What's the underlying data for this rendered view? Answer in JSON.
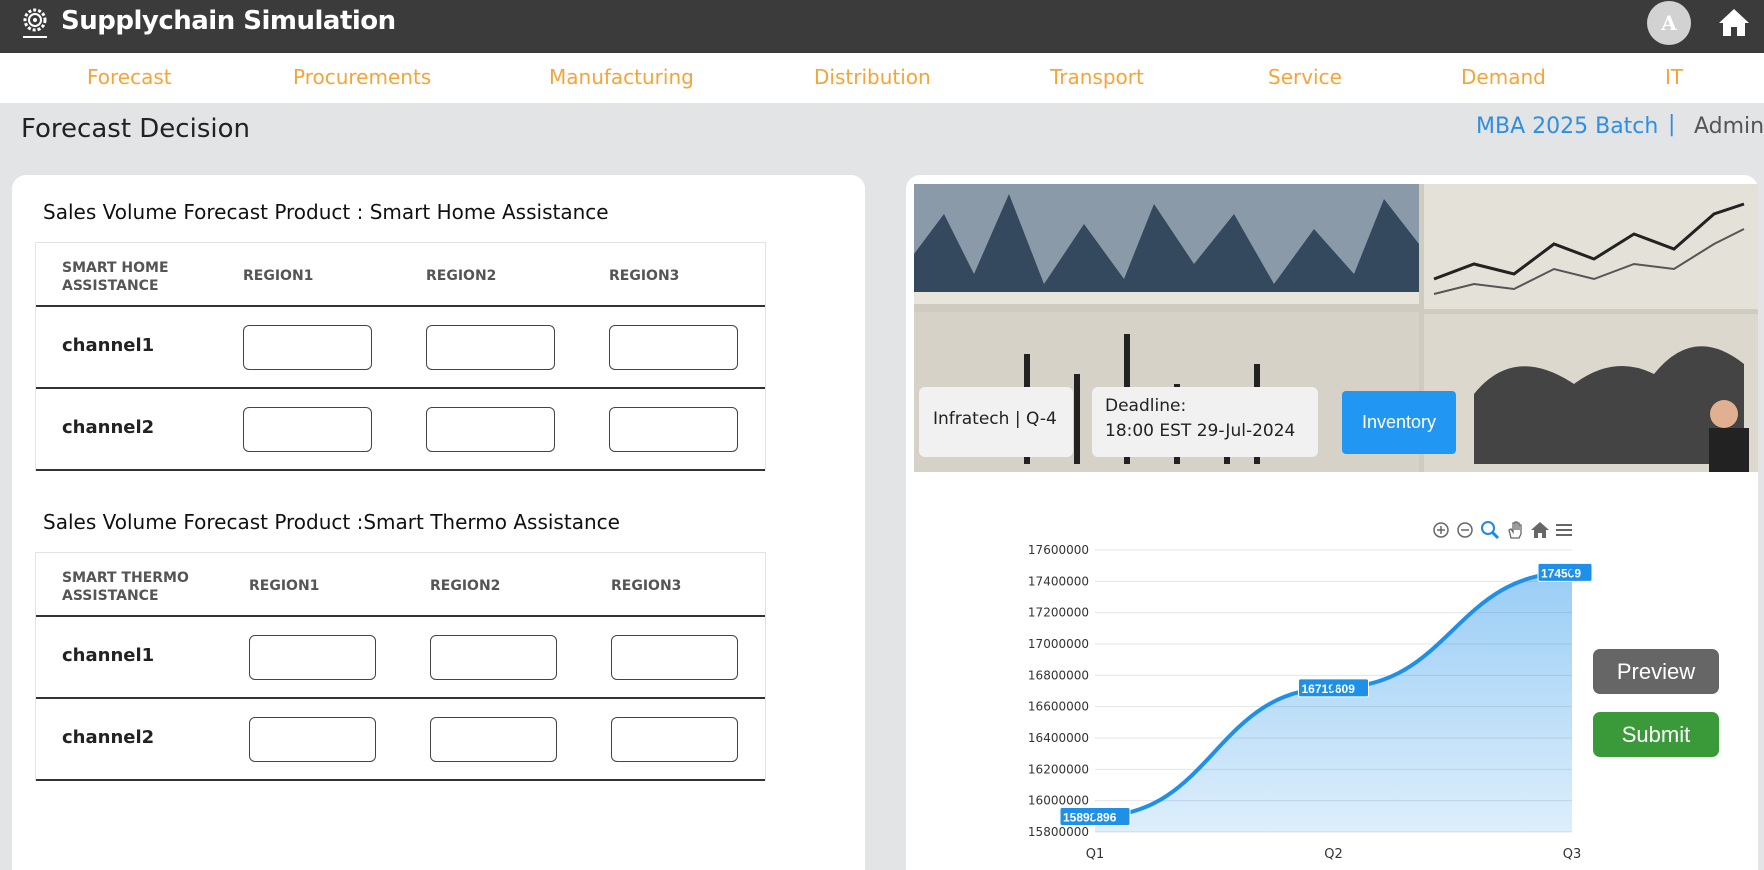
{
  "app": {
    "title": "Supplychain Simulation",
    "avatar_letter": "A"
  },
  "nav": [
    "Forecast",
    "Procurements",
    "Manufacturing",
    "Distribution",
    "Transport",
    "Service",
    "Demand",
    "IT"
  ],
  "page": {
    "title": "Forecast Decision",
    "batch": "MBA 2025 Batch",
    "separator": "|",
    "role": "Admin"
  },
  "table1": {
    "title": "Sales Volume Forecast Product : Smart Home Assistance",
    "headers": [
      "SMART HOME ASSISTANCE",
      "REGION1",
      "REGION2",
      "REGION3"
    ],
    "rows": [
      "channel1",
      "channel2"
    ]
  },
  "table2": {
    "title": "Sales Volume Forecast Product :Smart Thermo Assistance",
    "headers": [
      "SMART THERMO ASSISTANCE",
      "REGION1",
      "REGION2",
      "REGION3"
    ],
    "rows": [
      "channel1",
      "channel2"
    ]
  },
  "banner": {
    "company": "Infratech | Q-4",
    "deadline_label": "Deadline:",
    "deadline_value": "18:00 EST 29-Jul-2024",
    "inventory_button": "Inventory"
  },
  "chart_toolbar": [
    "zoom-in-icon",
    "zoom-out-icon",
    "selection-zoom-icon",
    "pan-icon",
    "reset-home-icon",
    "menu-icon"
  ],
  "chart_data": {
    "type": "area",
    "categories": [
      "Q1",
      "Q2",
      "Q3"
    ],
    "series": [
      {
        "values": [
          15898896,
          16719609,
          17456900
        ]
      }
    ],
    "data_labels": [
      "15898896",
      "16719609",
      "174569"
    ],
    "ylim": [
      15800000,
      17600000
    ],
    "yticks": [
      "17600000",
      "17400000",
      "17200000",
      "17000000",
      "16800000",
      "16600000",
      "16400000",
      "16200000",
      "16000000",
      "15800000"
    ],
    "color": "#1e90e8",
    "grid": true
  },
  "actions": {
    "preview": "Preview",
    "submit": "Submit"
  },
  "colors": {
    "topbar": "#3b3b3b",
    "nav_text": "#f5a43a",
    "accent_blue": "#2196f3",
    "submit_green": "#3a9a3a"
  }
}
